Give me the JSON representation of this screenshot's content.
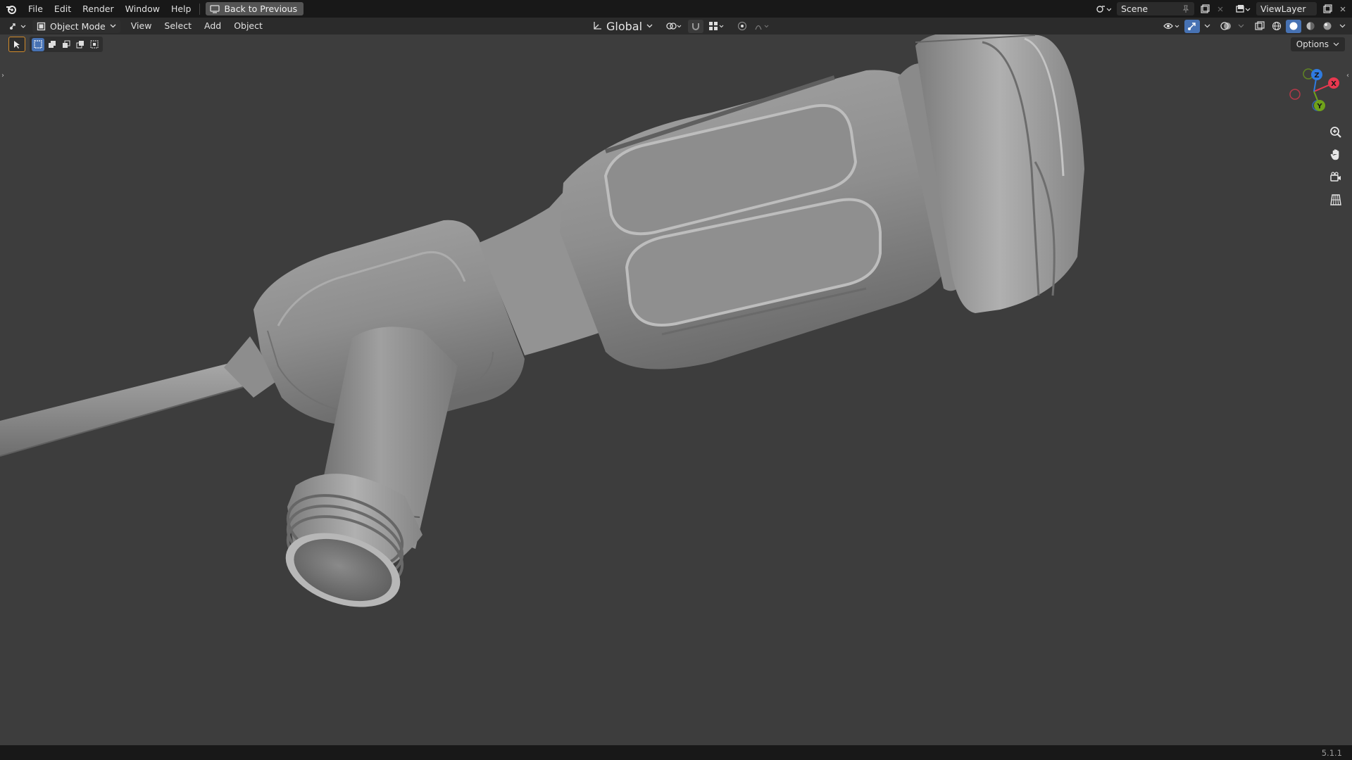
{
  "topbar": {
    "menus": [
      "File",
      "Edit",
      "Render",
      "Window",
      "Help"
    ],
    "back_button": "Back to Previous",
    "scene_name": "Scene",
    "view_layer": "ViewLayer"
  },
  "header": {
    "mode": "Object Mode",
    "menus": [
      "View",
      "Select",
      "Add",
      "Object"
    ],
    "transform_orientation": "Global",
    "options_label": "Options"
  },
  "status": {
    "version": "5.1.1"
  },
  "gizmo": {
    "x_label": "X",
    "y_label": "Y",
    "z_label": "Z",
    "x_color": "#e8384f",
    "y_color": "#6fa21a",
    "z_color": "#2f7be0"
  },
  "theme": {
    "viewport_bg": "#3d3d3d",
    "accent_blue": "#4772b3"
  }
}
